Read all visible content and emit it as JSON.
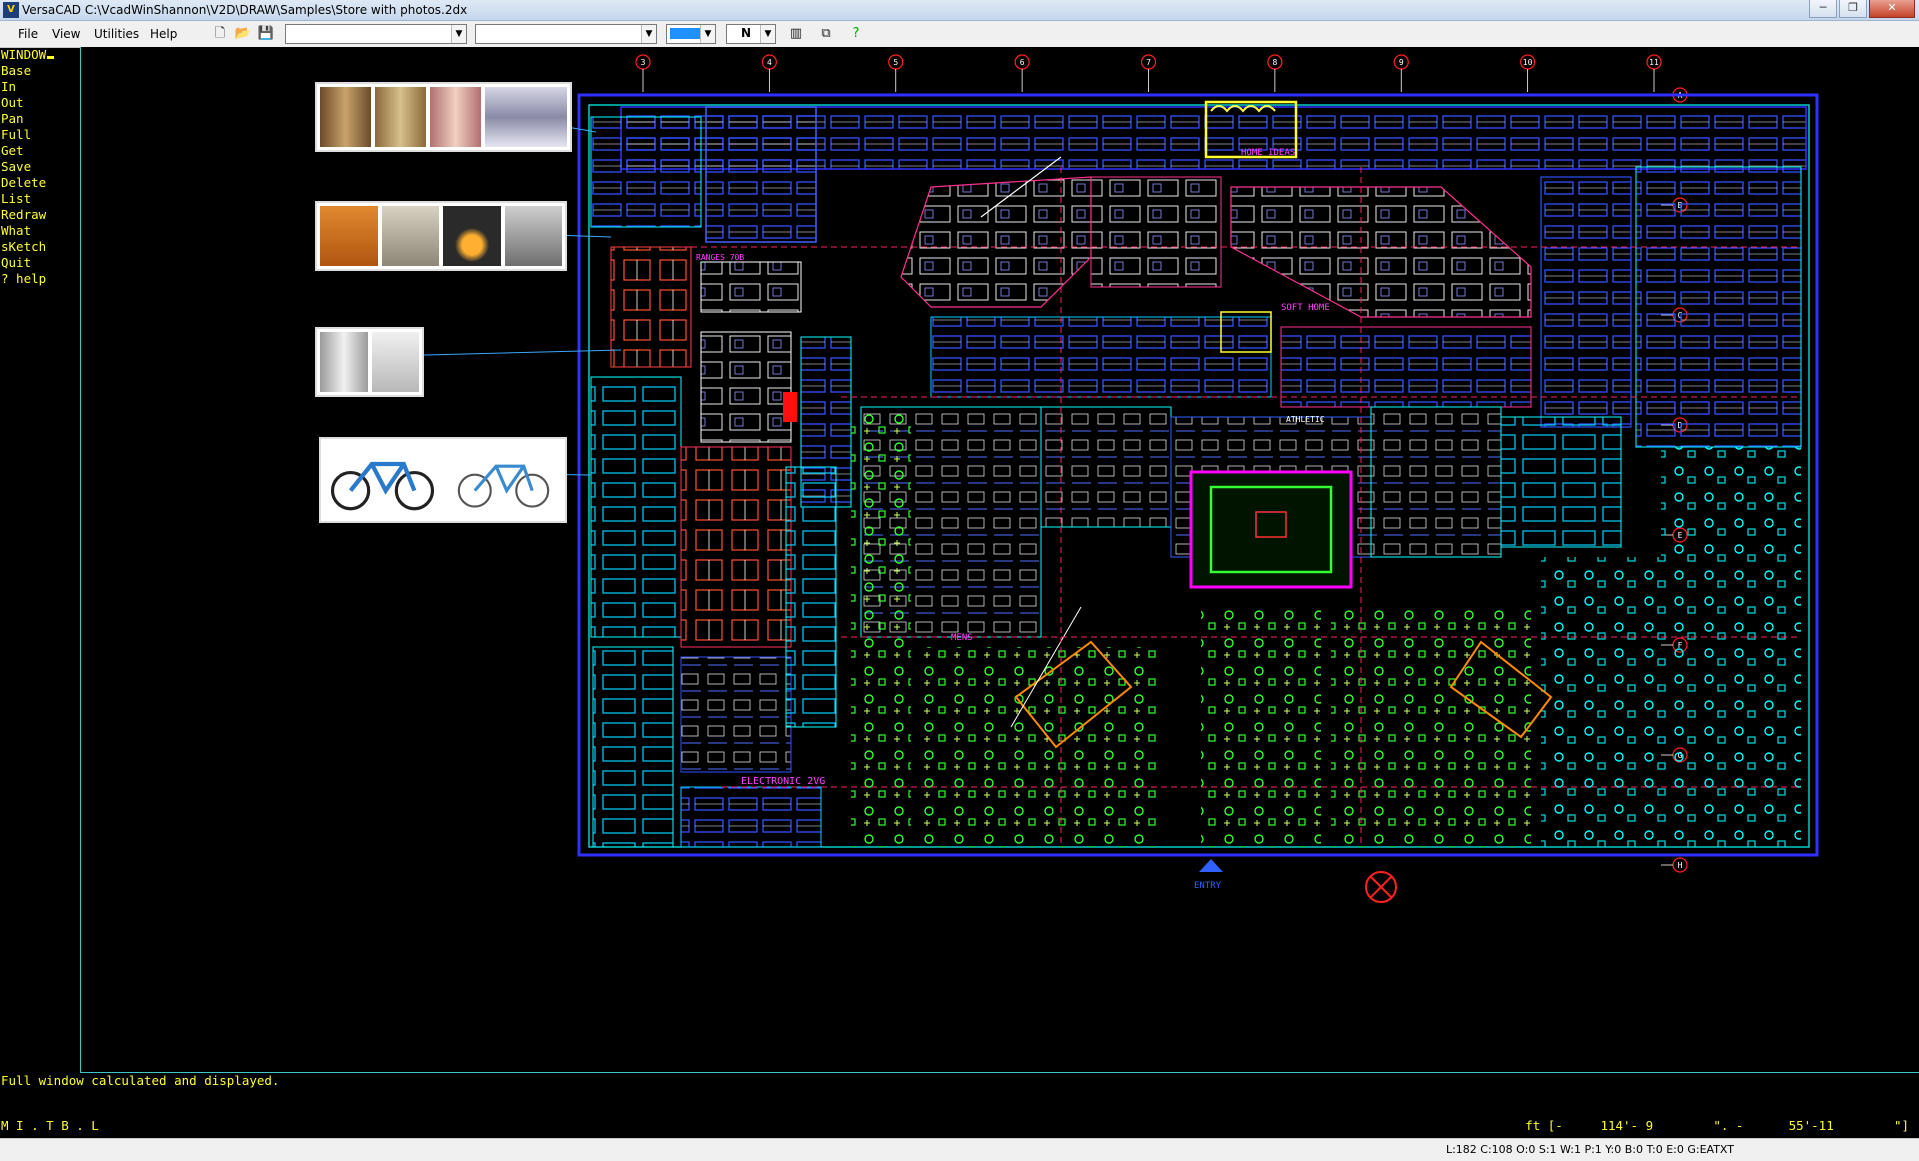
{
  "window": {
    "app_icon": "V",
    "title": "VersaCAD  C:\\VcadWinShannon\\V2D\\DRAW\\Samples\\Store with photos.2dx",
    "minimize": "─",
    "restore": "❐",
    "close": "✕"
  },
  "menu": {
    "items": [
      {
        "label": "File"
      },
      {
        "label": "View"
      },
      {
        "label": "Utilities"
      },
      {
        "label": "Help"
      }
    ]
  },
  "toolbar": {
    "combo1_value": "",
    "combo2_value": "",
    "color_value": "#1e90ff",
    "pen_value": "N"
  },
  "commands": {
    "items": [
      "WINDOW",
      "Base",
      "In",
      "Out",
      "Pan",
      "Full",
      "Get",
      "Save",
      "Delete",
      "List",
      "Redraw",
      "What",
      "sKetch",
      "Quit",
      "? help"
    ]
  },
  "message": "Full window calculated and displayed.",
  "prompt": "M I . T B . L",
  "coords": "ft [-     114'- 9        \". -      55'-11        \"]",
  "status": "L:182 C:108 O:0 S:1 W:1 P:1 Y:0 B:0 T:0 E:0 G:EATXT",
  "plan": {
    "column_grid": [
      "3",
      "4",
      "5",
      "6",
      "7",
      "8",
      "9",
      "10",
      "11"
    ],
    "row_grid": [
      "A",
      "B",
      "C",
      "D",
      "E",
      "F",
      "G",
      "H"
    ],
    "labels": {
      "home_ideas": "HOME IDEAS",
      "soft_home": "SOFT HOME",
      "mens": "MENS",
      "electronics": "ELECTRONIC 2VG",
      "entry": "ENTRY",
      "ranges": "RANGES 70B",
      "athletic": "ATHLETIC"
    }
  },
  "colors": {
    "cad_yellow": "#ffff33",
    "cad_cyan": "#00ffff",
    "cad_magenta": "#ff00ff",
    "cad_blue": "#2040ff",
    "cad_green": "#33ff33",
    "cad_red": "#ff2020"
  }
}
